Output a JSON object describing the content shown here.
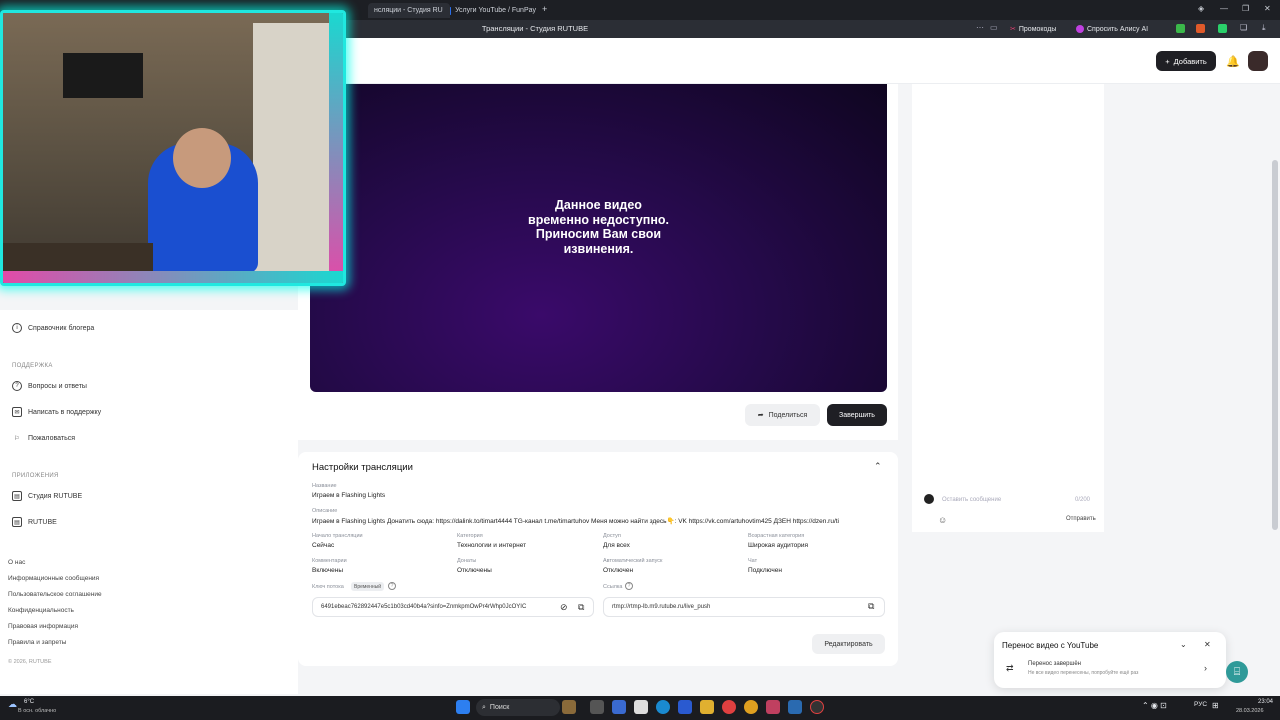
{
  "browser": {
    "tabs": [
      "нсляции - Студия RU",
      "Услуги YouTube / FunPay"
    ],
    "page_title": "Трансляции - Студия RUTUBE",
    "promo_chip": "Промокоды",
    "alice_chip": "Спросить Алису AI"
  },
  "header": {
    "add_button": "Добавить"
  },
  "sidebar": {
    "reference": "Справочник блогера",
    "support_head": "ПОДДЕРЖКА",
    "support_items": [
      "Вопросы и ответы",
      "Написать в поддержку",
      "Пожаловаться"
    ],
    "apps_head": "ПРИЛОЖЕНИЯ",
    "apps_items": [
      "Студия RUTUBE",
      "RUTUBE"
    ],
    "footer": [
      "О нас",
      "Информационные сообщения",
      "Пользовательское соглашение",
      "Конфиденциальность",
      "Правовая информация",
      "Правила и запреты",
      "© 2026, RUTUBE"
    ]
  },
  "player": {
    "message_l1": "Данное видео",
    "message_l2": "временно недоступно.",
    "message_l3": "Приносим Вам свои",
    "message_l4": "извинения."
  },
  "actions": {
    "share": "Поделиться",
    "finish": "Завершить"
  },
  "settings": {
    "title": "Настройки трансляции",
    "name_label": "Название",
    "name_value": "Играем в Flashing Lights",
    "desc_label": "Описание",
    "desc_value": "Играем в Flashing Lights Донатить сюда: https://dalink.to/timart4444 TG-канал t.me/timartuhov Меня можно найти здесь👇: VK https://vk.com/artuhovtim425 ДЗЕН https://dzen.ru/ti",
    "start_label": "Начало трансляции",
    "start_value": "Сейчас",
    "category_label": "Категория",
    "category_value": "Технологии и интернет",
    "access_label": "Доступ",
    "access_value": "Для всех",
    "age_label": "Возрастная категория",
    "age_value": "Широкая аудитория",
    "comments_label": "Комментарии",
    "comments_value": "Включены",
    "donates_label": "Донаты",
    "donates_value": "Отключены",
    "autostart_label": "Автоматический запуск",
    "autostart_value": "Отключен",
    "chat_label": "Чат",
    "chat_value": "Подключен",
    "key_label": "Ключ потока",
    "key_badge": "Временный",
    "key_value": "6491ebeac762892447e5c1b03cd40b4a?sinfo=ZnmkpmOwPr4rWhp0JcOYIC",
    "link_label": "Ссылка",
    "link_value": "rtmp://rtmp-lb.m9.rutube.ru/live_push",
    "edit_button": "Редактировать"
  },
  "chat": {
    "placeholder": "Оставить сообщение",
    "counter": "0/200",
    "send": "Отправить"
  },
  "toast": {
    "title": "Перенос видео с YouTube",
    "line1": "Перенос завершён",
    "line2": "Не все видео перенесены, попробуйте ещё раз"
  },
  "taskbar": {
    "weather_temp": "6°C",
    "weather_desc": "В осн. облачно",
    "search": "Поиск",
    "lang": "РУС",
    "time": "23:04",
    "date": "28.03.2026"
  },
  "colors": {
    "accent": "#1f1f24",
    "cam_border": "#20e8e0",
    "toast_fab": "#2f9a99"
  }
}
